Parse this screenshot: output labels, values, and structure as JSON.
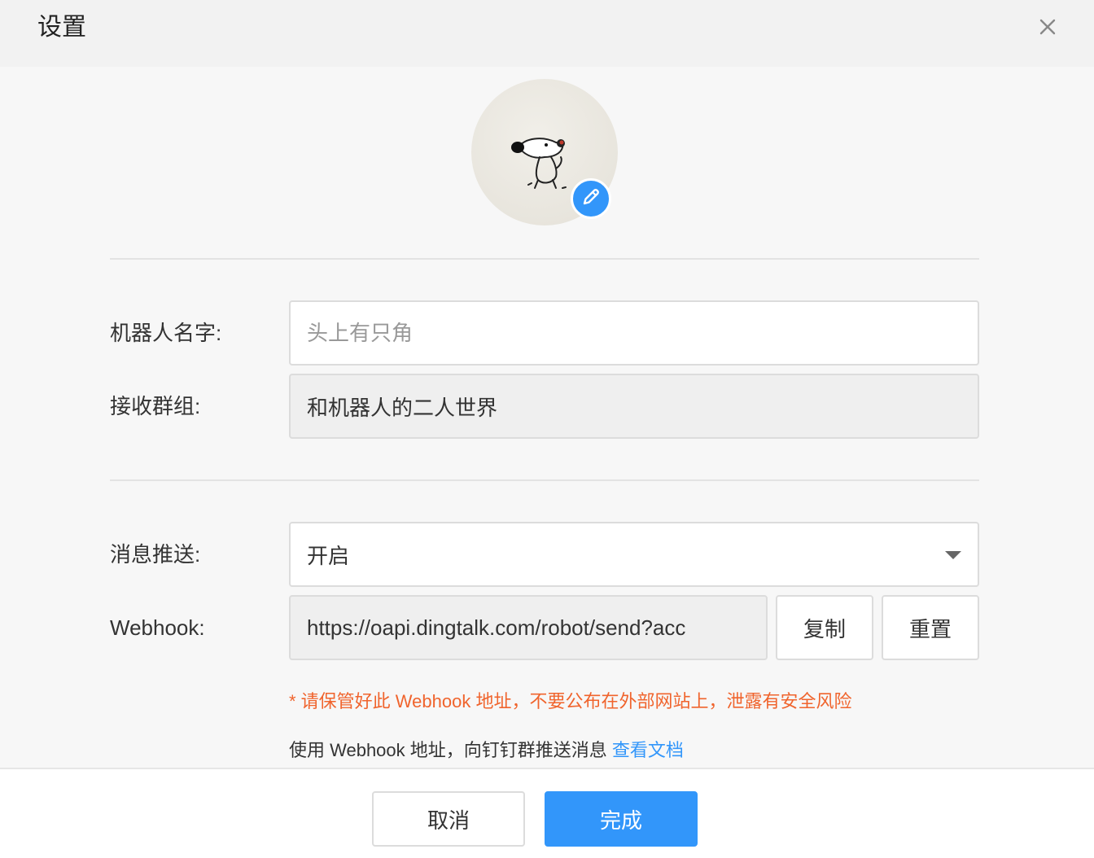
{
  "header": {
    "title": "设置"
  },
  "icons": {
    "close": "close-icon",
    "edit": "pencil-icon",
    "dropdown": "caret-down-icon"
  },
  "form": {
    "robot_name": {
      "label": "机器人名字:",
      "value": "",
      "placeholder": "头上有只角"
    },
    "receive_group": {
      "label": "接收群组:",
      "value": "和机器人的二人世界"
    },
    "message_push": {
      "label": "消息推送:",
      "value": "开启"
    },
    "webhook": {
      "label": "Webhook:",
      "value": "https://oapi.dingtalk.com/robot/send?acc",
      "copy_label": "复制",
      "reset_label": "重置"
    }
  },
  "warning": "* 请保管好此 Webhook 地址，不要公布在外部网站上，泄露有安全风险",
  "hint": {
    "text": "使用 Webhook 地址，向钉钉群推送消息 ",
    "link": "查看文档"
  },
  "footer": {
    "cancel_label": "取消",
    "done_label": "完成"
  },
  "colors": {
    "accent": "#3296fa",
    "warning": "#f0642d",
    "disabled_bg": "#efefef"
  }
}
